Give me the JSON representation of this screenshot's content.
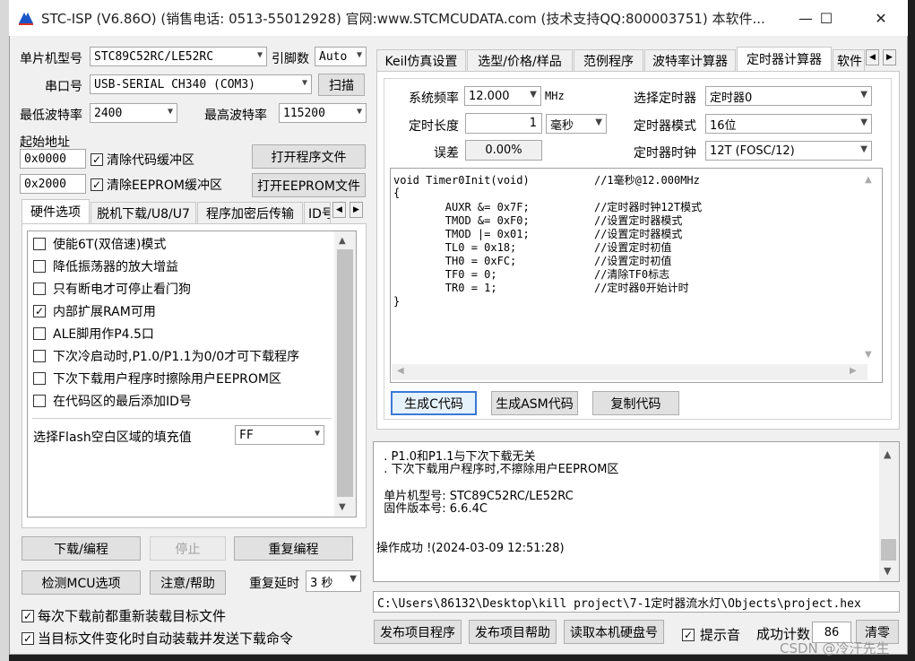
{
  "window": {
    "title": "STC-ISP (V6.86O) (销售电话: 0513-55012928) 官网:www.STCMCUDATA.com  (技术支持QQ:800003751) 本软件...",
    "minimize": "—",
    "maximize": "☐",
    "close": "✕"
  },
  "left": {
    "mcu_label": "单片机型号",
    "mcu_value": "STC89C52RC/LE52RC",
    "pins_label": "引脚数",
    "pins_value": "Auto",
    "port_label": "串口号",
    "port_value": "USB-SERIAL CH340 (COM3)",
    "scan_button": "扫描",
    "min_baud_label": "最低波特率",
    "min_baud_value": "2400",
    "max_baud_label": "最高波特率",
    "max_baud_value": "115200",
    "start_addr_label": "起始地址",
    "addr1_value": "0x0000",
    "clear_code_label": "清除代码缓冲区",
    "open_program_button": "打开程序文件",
    "addr2_value": "0x2000",
    "clear_eeprom_label": "清除EEPROM缓冲区",
    "open_eeprom_button": "打开EEPROM文件",
    "tabs": [
      "硬件选项",
      "脱机下载/U8/U7",
      "程序加密后传输",
      "ID号"
    ],
    "options": [
      {
        "label": "使能6T(双倍速)模式",
        "checked": false
      },
      {
        "label": "降低振荡器的放大增益",
        "checked": false
      },
      {
        "label": "只有断电才可停止看门狗",
        "checked": false
      },
      {
        "label": "内部扩展RAM可用",
        "checked": true
      },
      {
        "label": "ALE脚用作P4.5口",
        "checked": false
      },
      {
        "label": "下次冷启动时,P1.0/P1.1为0/0才可下载程序",
        "checked": false
      },
      {
        "label": "下次下载用户程序时擦除用户EEPROM区",
        "checked": false
      },
      {
        "label": "在代码区的最后添加ID号",
        "checked": false
      }
    ],
    "fill_label": "选择Flash空白区域的填充值",
    "fill_value": "FF",
    "download_button": "下载/编程",
    "stop_button": "停止",
    "reprogram_button": "重复编程",
    "check_mcu_button": "检测MCU选项",
    "help_button": "注意/帮助",
    "repeat_delay_label": "重复延时",
    "repeat_delay_value": "3 秒",
    "reload_label": "每次下载前都重新装载目标文件",
    "auto_reload_label": "当目标文件变化时自动装载并发送下载命令",
    "check_mark": "✓"
  },
  "right": {
    "tabs": [
      "Keil仿真设置",
      "选型/价格/样品",
      "范例程序",
      "波特率计算器",
      "定时器计算器",
      "软件"
    ],
    "active_tab": "定时器计算器",
    "sysfreq_label": "系统频率",
    "sysfreq_value": "12.000",
    "sysfreq_unit": "MHz",
    "timer_select_label": "选择定时器",
    "timer_select_value": "定时器0",
    "length_label": "定时长度",
    "length_value": "1",
    "length_unit": "毫秒",
    "timer_mode_label": "定时器模式",
    "timer_mode_value": "16位",
    "error_label": "误差",
    "error_value": "0.00%",
    "timer_clock_label": "定时器时钟",
    "timer_clock_value": "12T (FOSC/12)",
    "code_lines": [
      "void Timer0Init(void)          //1毫秒@12.000MHz",
      "{",
      "        AUXR &= 0x7F;          //定时器时钟12T模式",
      "        TMOD &= 0xF0;          //设置定时器模式",
      "        TMOD |= 0x01;          //设置定时器模式",
      "        TL0 = 0x18;            //设置定时初值",
      "        TH0 = 0xFC;            //设置定时初值",
      "        TF0 = 0;               //清除TF0标志",
      "        TR0 = 1;               //定时器0开始计时",
      "}"
    ],
    "gen_c_button": "生成C代码",
    "gen_asm_button": "生成ASM代码",
    "copy_button": "复制代码",
    "log_lines": [
      "  . P1.0和P1.1与下次下载无关",
      "  . 下次下载用户程序时,不擦除用户EEPROM区",
      "",
      "  单片机型号: STC89C52RC/LE52RC",
      "  固件版本号: 6.6.4C",
      "",
      "",
      "操作成功 !(2024-03-09 12:51:28)"
    ],
    "file_path": "C:\\Users\\86132\\Desktop\\kill project\\7-1定时器流水灯\\Objects\\project.hex",
    "publish_button": "发布项目程序",
    "publish_help_button": "发布项目帮助",
    "read_disk_button": "读取本机硬盘号",
    "sound_label": "提示音",
    "count_label": "成功计数",
    "count_value": "86",
    "clear_button": "清零"
  },
  "watermark": "CSDN @冷汗先生"
}
